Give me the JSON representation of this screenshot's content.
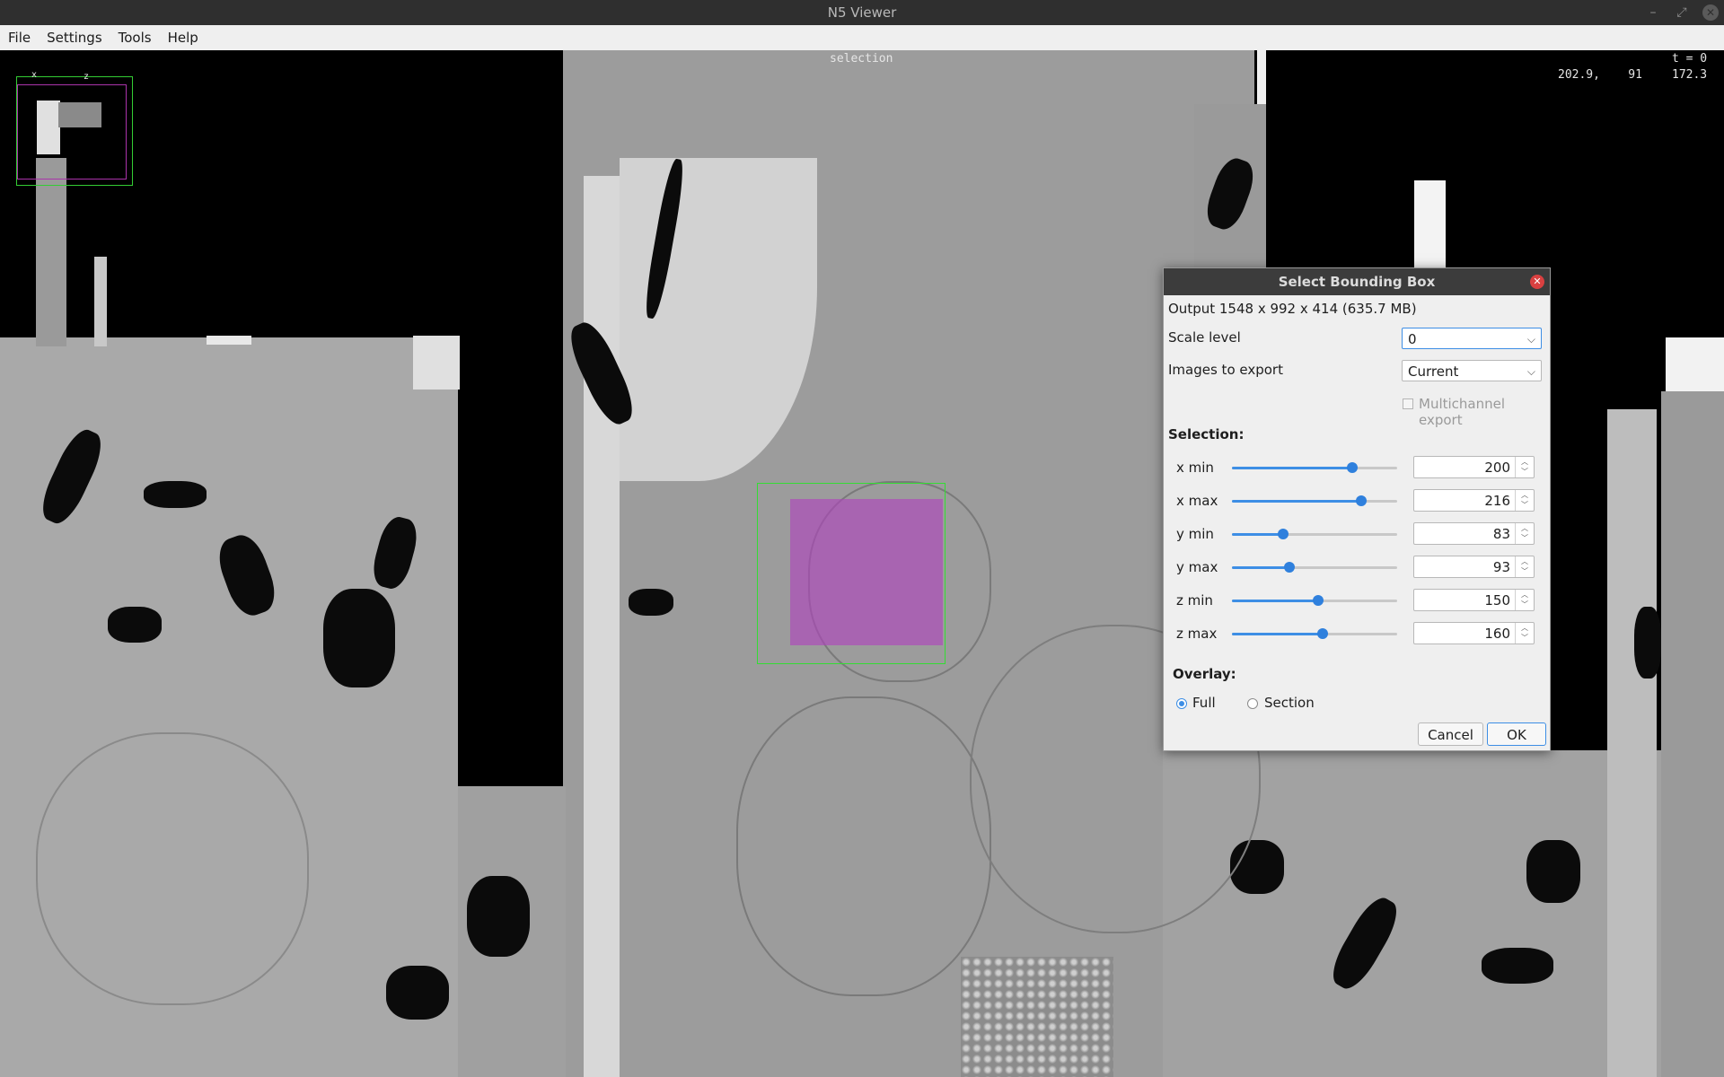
{
  "window": {
    "title": "N5 Viewer",
    "controls": [
      "minimize-icon",
      "maximize-icon",
      "close-icon"
    ]
  },
  "menubar": {
    "items": [
      "File",
      "Settings",
      "Tools",
      "Help"
    ]
  },
  "viewer": {
    "overlay_label": "selection",
    "coordinates": "202.9,    91",
    "time_label": "t = 0",
    "z_value": "172.3",
    "navigator_axes": [
      "x",
      "z"
    ],
    "selection_box_color": "#33dd33",
    "selection_fill_color": "#b040c0"
  },
  "dialog": {
    "title": "Select Bounding Box",
    "output_info": "Output 1548 x 992 x 414 (635.7 MB)",
    "scale_level": {
      "label": "Scale level",
      "value": "0"
    },
    "images_to_export": {
      "label": "Images to export",
      "value": "Current"
    },
    "multichannel": {
      "label": "Multichannel export",
      "checked": false,
      "enabled": false
    },
    "selection_heading": "Selection:",
    "rows": [
      {
        "label": "x min",
        "value": "200",
        "level": 0.73
      },
      {
        "label": "x max",
        "value": "216",
        "level": 0.78
      },
      {
        "label": "y min",
        "value": "83",
        "level": 0.31
      },
      {
        "label": "y max",
        "value": "93",
        "level": 0.35
      },
      {
        "label": "z min",
        "value": "150",
        "level": 0.52
      },
      {
        "label": "z max",
        "value": "160",
        "level": 0.55
      }
    ],
    "overlay_heading": "Overlay:",
    "overlay_options": [
      {
        "label": "Full",
        "selected": true
      },
      {
        "label": "Section",
        "selected": false
      }
    ],
    "cancel_label": "Cancel",
    "ok_label": "OK"
  }
}
